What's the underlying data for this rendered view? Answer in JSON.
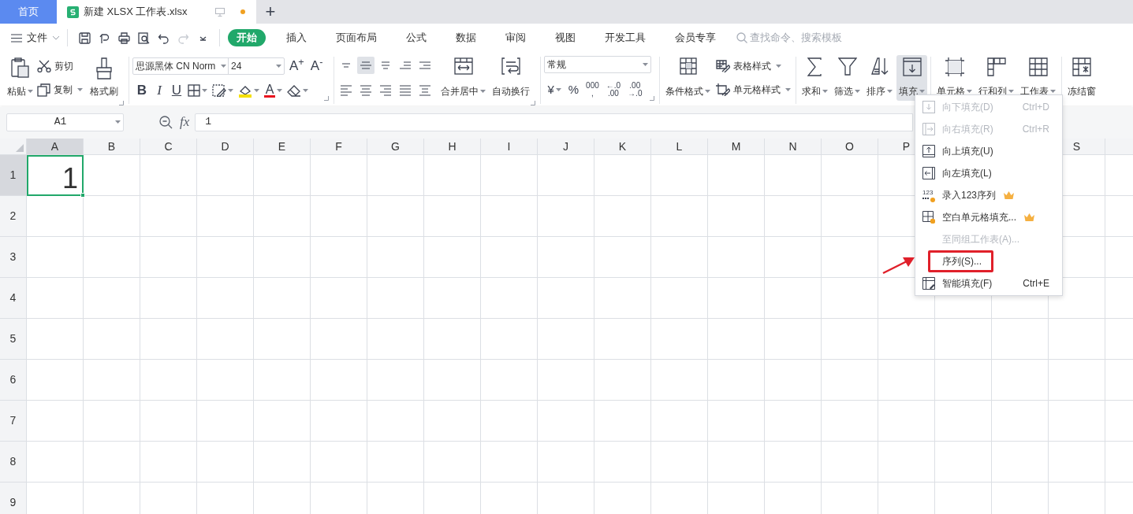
{
  "title_bar": {
    "tabs": [
      {
        "label": "首页",
        "kind": "home",
        "selected": false
      },
      {
        "label": "新建 XLSX 工作表.xlsx",
        "kind": "document",
        "selected": true,
        "unsaved": true
      }
    ],
    "new_tab": "+"
  },
  "menu_bar": {
    "file_menu": "文件",
    "tabs": [
      {
        "label": "开始",
        "selected": true
      },
      {
        "label": "插入",
        "selected": false
      },
      {
        "label": "页面布局",
        "selected": false
      },
      {
        "label": "公式",
        "selected": false
      },
      {
        "label": "数据",
        "selected": false
      },
      {
        "label": "审阅",
        "selected": false
      },
      {
        "label": "视图",
        "selected": false
      },
      {
        "label": "开发工具",
        "selected": false
      },
      {
        "label": "会员专享",
        "selected": false
      }
    ],
    "search": {
      "placeholder": "查找命令、搜索模板"
    }
  },
  "ribbon": {
    "clipboard": {
      "paste": "粘贴",
      "cut": "剪切",
      "copy": "复制",
      "format_painter": "格式刷"
    },
    "font": {
      "name": "思源黑体 CN Norm",
      "size": "24",
      "grow": "A$^{+}$",
      "shrink": "A$^{-}$",
      "bold": "B",
      "italic": "I",
      "underline": "U",
      "font_color": "A"
    },
    "alignment": {
      "merge": "合并居中",
      "wrap": "自动换行"
    },
    "number": {
      "format": "常规",
      "buttons": [
        {
          "lines": [
            "¥"
          ],
          "dropdown": true
        },
        {
          "lines": [
            "%"
          ],
          "dropdown": false
        },
        {
          "lines": [
            "000",
            ","
          ],
          "dropdown": false
        },
        {
          "lines": [
            "←.0",
            ".00"
          ],
          "dropdown": false
        },
        {
          "lines": [
            ".00",
            "→.0"
          ],
          "dropdown": false
        }
      ]
    },
    "conditional_format": "条件格式",
    "styles": [
      "表格样式",
      "单元格样式"
    ],
    "tool_groups": [
      [
        {
          "label": "求和",
          "dropdown": true,
          "selected": false
        },
        {
          "label": "筛选",
          "dropdown": true,
          "selected": false
        },
        {
          "label": "排序",
          "dropdown": true,
          "selected": false
        },
        {
          "label": "填充",
          "dropdown": true,
          "selected": true
        }
      ],
      [
        {
          "label": "单元格",
          "dropdown": true,
          "selected": false
        },
        {
          "label": "行和列",
          "dropdown": true,
          "selected": false
        },
        {
          "label": "工作表",
          "dropdown": true,
          "selected": false
        }
      ],
      [
        {
          "label": "冻结窗",
          "dropdown": false,
          "selected": false
        }
      ]
    ]
  },
  "formula_bar": {
    "name_box": "A1",
    "fx": "fx",
    "formula": "1"
  },
  "sheet": {
    "columns": [
      {
        "label": "A",
        "selected": true
      },
      {
        "label": "B",
        "selected": false
      },
      {
        "label": "C",
        "selected": false
      },
      {
        "label": "D",
        "selected": false
      },
      {
        "label": "E",
        "selected": false
      },
      {
        "label": "F",
        "selected": false
      },
      {
        "label": "G",
        "selected": false
      },
      {
        "label": "H",
        "selected": false
      },
      {
        "label": "I",
        "selected": false
      },
      {
        "label": "J",
        "selected": false
      },
      {
        "label": "K",
        "selected": false
      },
      {
        "label": "L",
        "selected": false
      },
      {
        "label": "M",
        "selected": false
      },
      {
        "label": "N",
        "selected": false
      },
      {
        "label": "O",
        "selected": false
      },
      {
        "label": "P",
        "selected": false
      }
    ],
    "columns_after_menu": [
      {
        "label": "S",
        "selected": false
      }
    ],
    "rows": [
      {
        "label": "1",
        "selected": true,
        "cells": [
          "1"
        ]
      },
      {
        "label": "2",
        "selected": false,
        "cells": []
      },
      {
        "label": "3",
        "selected": false,
        "cells": []
      },
      {
        "label": "4",
        "selected": false,
        "cells": []
      },
      {
        "label": "5",
        "selected": false,
        "cells": []
      },
      {
        "label": "6",
        "selected": false,
        "cells": []
      },
      {
        "label": "7",
        "selected": false,
        "cells": []
      },
      {
        "label": "8",
        "selected": false,
        "cells": []
      },
      {
        "label": "9",
        "selected": false,
        "cells": []
      }
    ]
  },
  "fill_menu": {
    "items": [
      {
        "label": "向下填充(D)",
        "shortcut": "Ctrl+D",
        "disabled": true,
        "premium": false,
        "annotated": false
      },
      {
        "label": "向右填充(R)",
        "shortcut": "Ctrl+R",
        "disabled": true,
        "premium": false,
        "annotated": false
      },
      {
        "label": "向上填充(U)",
        "disabled": false,
        "premium": false,
        "annotated": false
      },
      {
        "label": "向左填充(L)",
        "disabled": false,
        "premium": false,
        "annotated": false
      },
      {
        "label": "录入123序列",
        "icon_text": "123",
        "disabled": false,
        "premium": true,
        "annotated": false
      },
      {
        "label": "空白单元格填充...",
        "disabled": false,
        "premium": true,
        "annotated": false
      },
      {
        "label": "至同组工作表(A)...",
        "disabled": true,
        "premium": false,
        "annotated": false
      },
      {
        "label": "序列(S)...",
        "disabled": false,
        "premium": false,
        "annotated": true
      },
      {
        "label": "智能填充(F)",
        "shortcut": "Ctrl+E",
        "disabled": false,
        "premium": false,
        "annotated": false
      }
    ]
  }
}
